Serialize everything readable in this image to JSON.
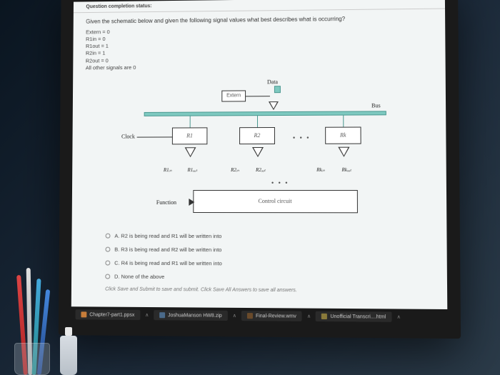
{
  "header": "Question completion status:",
  "question": "Given the schematic below and given the following signal values what best describes what is occurring?",
  "signals": [
    "Extern = 0",
    "R1in = 0",
    "R1out = 1",
    "R2in = 1",
    "R2out = 0",
    "All other signals are 0"
  ],
  "diagram": {
    "data_label": "Data",
    "extern_label": "Extern",
    "bus_label": "Bus",
    "clock_label": "Clock",
    "reg1": "R1",
    "reg2": "R2",
    "regk": "Rk",
    "sig_r1in": "R1ᵢₙ",
    "sig_r1out": "R1ₒᵤₜ",
    "sig_r2in": "R2ᵢₙ",
    "sig_r2out": "R2ₒᵤₜ",
    "sig_rkin": "Rkᵢₙ",
    "sig_rkout": "Rkₒᵤₜ",
    "control_label": "Control circuit",
    "function_label": "Function"
  },
  "options": [
    "A. R2 is being read and R1 will be written into",
    "B. R3 is being read and R2 will be written into",
    "C. R4 is being read and R1 will be written into",
    "D. None of the above"
  ],
  "hint": "Click Save and Submit to save and submit. Click Save All Answers to save all answers.",
  "taskbar": {
    "items": [
      "Chapter7-part1.ppsx",
      "JoshuaManson HW8.zip",
      "Final-Review.wmv",
      "Unofficial Transcri....html"
    ]
  }
}
